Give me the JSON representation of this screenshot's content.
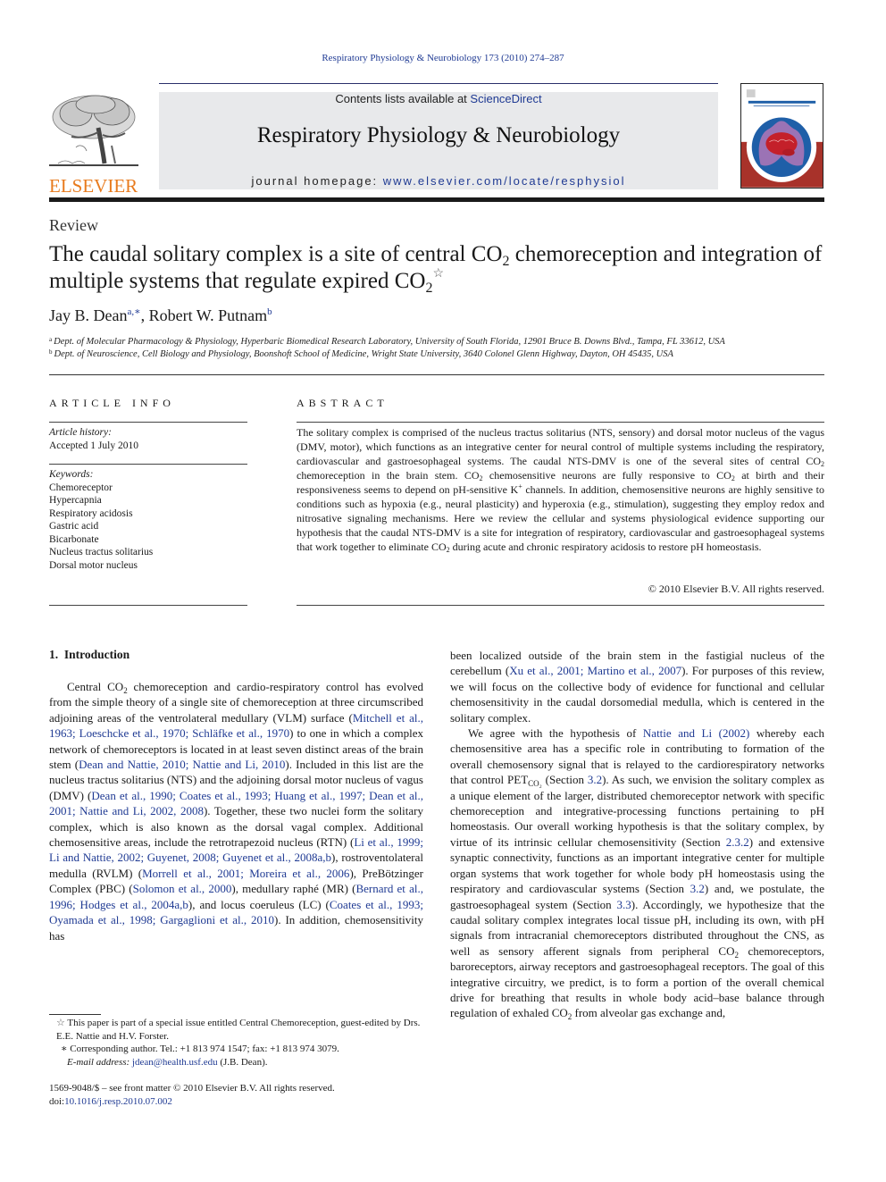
{
  "running_header": "Respiratory Physiology & Neurobiology 173 (2010) 274–287",
  "masthead": {
    "publisher_name": "ELSEVIER",
    "contents_prefix": "Contents lists available at ",
    "contents_link": "ScienceDirect",
    "journal_title": "Respiratory Physiology & Neurobiology",
    "homepage_prefix": "journal homepage: ",
    "homepage_link": "www.elsevier.com/locate/resphysiol",
    "cover_alt": "Respiratory Physiology & Neurobiology cover",
    "colors": {
      "publisher_orange": "#e87b1e",
      "link_blue": "#1f3a93",
      "banner_gray": "#e8e9eb",
      "cover_red": "#a8322a",
      "cover_blue": "#1f5fa8",
      "cover_purple": "#9b73b5"
    }
  },
  "article": {
    "type": "Review",
    "title_part1": "The caudal solitary complex is a site of central CO",
    "title_sub1": "2",
    "title_part2": " chemoreception and integration of multiple systems that regulate expired CO",
    "title_sub2": "2",
    "title_star": "☆",
    "authors": [
      {
        "name": "Jay B. Dean",
        "marks": "a,∗"
      },
      {
        "name": "Robert W. Putnam",
        "marks": "b"
      }
    ],
    "author_separator": ", ",
    "affiliations": [
      {
        "mark": "a",
        "text": "Dept. of Molecular Pharmacology & Physiology, Hyperbaric Biomedical Research Laboratory, University of South Florida, 12901 Bruce B. Downs Blvd., Tampa, FL 33612, USA"
      },
      {
        "mark": "b",
        "text": "Dept. of Neuroscience, Cell Biology and Physiology, Boonshoft School of Medicine, Wright State University, 3640 Colonel Glenn Highway, Dayton, OH 45435, USA"
      }
    ]
  },
  "article_info": {
    "heading": "ARTICLE INFO",
    "history_label": "Article history:",
    "history_value": "Accepted 1 July 2010",
    "keywords_label": "Keywords:",
    "keywords": [
      "Chemoreceptor",
      "Hypercapnia",
      "Respiratory acidosis",
      "Gastric acid",
      "Bicarbonate",
      "Nucleus tractus solitarius",
      "Dorsal motor nucleus"
    ]
  },
  "abstract": {
    "heading": "ABSTRACT",
    "segments": [
      "The solitary complex is comprised of the nucleus tractus solitarius (NTS, sensory) and dorsal motor nucleus of the vagus (DMV, motor), which functions as an integrative center for neural control of multiple systems including the respiratory, cardiovascular and gastroesophageal systems. The caudal NTS-DMV is one of the several sites of central CO",
      "2",
      " chemoreception in the brain stem. CO",
      "2",
      " chemosensitive neurons are fully responsive to CO",
      "2",
      " at birth and their responsiveness seems to depend on pH-sensitive K",
      "+",
      " channels. In addition, chemosensitive neurons are highly sensitive to conditions such as hypoxia (e.g., neural plasticity) and hyperoxia (e.g., stimulation), suggesting they employ redox and nitrosative signaling mechanisms. Here we review the cellular and systems physiological evidence supporting our hypothesis that the caudal NTS-DMV is a site for integration of respiratory, cardiovascular and gastroesophageal systems that work together to eliminate CO",
      "2",
      " during acute and chronic respiratory acidosis to restore pH homeostasis."
    ],
    "copyright": "© 2010 Elsevier B.V. All rights reserved."
  },
  "body": {
    "section_number": "1.",
    "section_title": "Introduction",
    "left_para": [
      {
        "t": "Central CO"
      },
      {
        "sub": "2"
      },
      {
        "t": " chemoreception and cardio-respiratory control has evolved from the simple theory of a single site of chemoreception at three circumscribed adjoining areas of the ventrolateral medullary (VLM) surface ("
      },
      {
        "link": "Mitchell et al., 1963; Loeschcke et al., 1970; Schläfke et al., 1970"
      },
      {
        "t": ") to one in which a complex network of chemoreceptors is located in at least seven distinct areas of the brain stem ("
      },
      {
        "link": "Dean and Nattie, 2010; Nattie and Li, 2010"
      },
      {
        "t": "). Included in this list are the nucleus tractus solitarius (NTS) and the adjoining dorsal motor nucleus of vagus (DMV) ("
      },
      {
        "link": "Dean et al., 1990; Coates et al., 1993; Huang et al., 1997; Dean et al., 2001; Nattie and Li, 2002, 2008"
      },
      {
        "t": "). Together, these two nuclei form the solitary complex, which is also known as the dorsal vagal complex. Additional chemosensitive areas, include the retrotrapezoid nucleus (RTN) ("
      },
      {
        "link": "Li et al., 1999; Li and Nattie, 2002; Guyenet, 2008; Guyenet et al., 2008a,b"
      },
      {
        "t": "), rostroventolateral medulla (RVLM) ("
      },
      {
        "link": "Morrell et al., 2001; Moreira et al., 2006"
      },
      {
        "t": "), PreBötzinger Complex (PBC) ("
      },
      {
        "link": "Solomon et al., 2000"
      },
      {
        "t": "), medullary raphé (MR) ("
      },
      {
        "link": "Bernard et al., 1996; Hodges et al., 2004a,b"
      },
      {
        "t": "), and locus coeruleus (LC) ("
      },
      {
        "link": "Coates et al., 1993; Oyamada et al., 1998; Gargaglioni et al., 2010"
      },
      {
        "t": "). In addition, chemosensitivity has"
      }
    ],
    "right_para1": [
      {
        "t": "been localized outside of the brain stem in the fastigial nucleus of the cerebellum ("
      },
      {
        "link": "Xu et al., 2001; Martino et al., 2007"
      },
      {
        "t": "). For purposes of this review, we will focus on the collective body of evidence for functional and cellular chemosensitivity in the caudal dorsomedial medulla, which is centered in the solitary complex."
      }
    ],
    "right_para2": [
      {
        "t": "We agree with the hypothesis of "
      },
      {
        "link": "Nattie and Li (2002)"
      },
      {
        "t": " whereby each chemosensitive area has a specific role in contributing to formation of the overall chemosensory signal that is relayed to the cardiorespiratory networks that control PET"
      },
      {
        "sub": "CO₂"
      },
      {
        "t": " (Section "
      },
      {
        "link": "3.2"
      },
      {
        "t": "). As such, we envision the solitary complex as a unique element of the larger, distributed chemoreceptor network with specific chemoreception and integrative-processing functions pertaining to pH homeostasis. Our overall working hypothesis is that the solitary complex, by virtue of its intrinsic cellular chemosensitivity (Section "
      },
      {
        "link": "2.3.2"
      },
      {
        "t": ") and extensive synaptic connectivity, functions as an important integrative center for multiple organ systems that work together for whole body pH homeostasis using the respiratory and cardiovascular systems (Section "
      },
      {
        "link": "3.2"
      },
      {
        "t": ") and, we postulate, the gastroesophageal system (Section "
      },
      {
        "link": "3.3"
      },
      {
        "t": "). Accordingly, we hypothesize that the caudal solitary complex integrates local tissue pH, including its own, with pH signals from intracranial chemoreceptors distributed throughout the CNS, as well as sensory afferent signals from peripheral CO"
      },
      {
        "sub": "2"
      },
      {
        "t": " chemoreceptors, baroreceptors, airway receptors and gastroesophageal receptors. The goal of this integrative circuitry, we predict, is to form a portion of the overall chemical drive for breathing that results in whole body acid–base balance through regulation of exhaled CO"
      },
      {
        "sub": "2"
      },
      {
        "t": " from alveolar gas exchange and,"
      }
    ]
  },
  "footnotes": {
    "star_mark": "☆",
    "star_text": " This paper is part of a special issue entitled Central Chemoreception, guest-edited by Drs. E.E. Nattie and H.V. Forster.",
    "corr_mark": "∗",
    "corr_text": " Corresponding author. Tel.: +1 813 974 1547; fax: +1 813 974 3079.",
    "email_label": "E-mail address:",
    "email": "jdean@health.usf.edu",
    "email_suffix": " (J.B. Dean)."
  },
  "front_matter": {
    "issn_line": "1569-9048/$ – see front matter © 2010 Elsevier B.V. All rights reserved.",
    "doi_prefix": "doi:",
    "doi": "10.1016/j.resp.2010.07.002"
  }
}
